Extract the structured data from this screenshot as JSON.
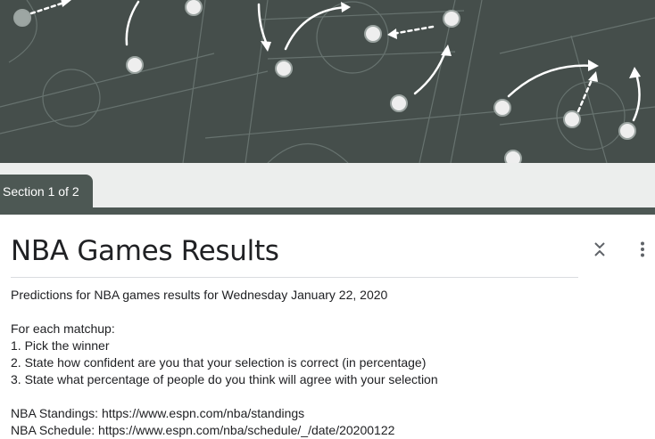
{
  "tab": {
    "section_label": "Section 1 of 2"
  },
  "form": {
    "title": "NBA Games Results",
    "description": [
      "Predictions for NBA games results for Wednesday January 22, 2020",
      "",
      "For each matchup:",
      "1. Pick the winner",
      "2. State how confident are you that your selection is correct (in percentage)",
      "3. State what percentage of people do you think will agree with your selection",
      "",
      "NBA Standings: https://www.espn.com/nba/standings",
      "NBA Schedule: https://www.espn.com/nba/schedule/_/date/20200122"
    ]
  },
  "icons": {
    "collapse": "collapse-chevrons-icon",
    "more": "more-vertical-icon"
  },
  "colors": {
    "theme": "#4d5854",
    "banner": "#454e4b",
    "text": "#202124"
  }
}
